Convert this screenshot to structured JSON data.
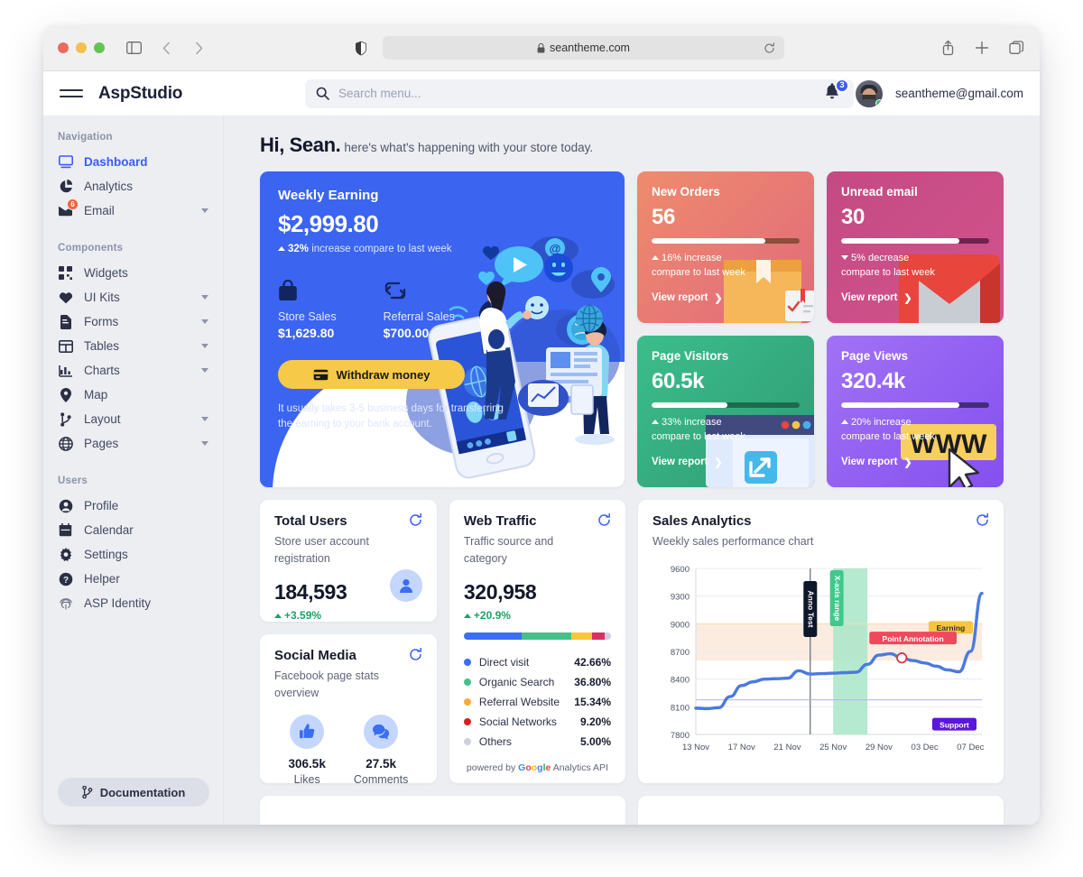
{
  "browser": {
    "url": "seantheme.com",
    "lock_icon": "lock-icon",
    "reload_icon": "reload-icon",
    "back_icon": "back-arrow-icon",
    "forward_icon": "forward-arrow-icon",
    "sidebar_icon": "sidebar-toggle-icon",
    "shield_icon": "shield-icon",
    "share_icon": "share-icon",
    "newtab_icon": "plus-icon",
    "tabs_icon": "tabs-icon"
  },
  "header": {
    "brand": "AspStudio",
    "menu_icon": "hamburger-menu-icon",
    "search": {
      "placeholder": "Search menu...",
      "value": "",
      "icon": "search-icon"
    },
    "notifications": {
      "count": "3",
      "icon": "bell-icon"
    },
    "user": {
      "email": "seantheme@gmail.com",
      "avatar": "user-avatar"
    }
  },
  "sidebar": {
    "sections": [
      {
        "title": "Navigation",
        "items": [
          {
            "label": "Dashboard",
            "icon": "monitor-icon",
            "active": true,
            "caret": false
          },
          {
            "label": "Analytics",
            "icon": "pie-chart-icon",
            "active": false,
            "caret": false
          },
          {
            "label": "Email",
            "icon": "envelope-icon",
            "active": false,
            "caret": true,
            "badge": "6"
          }
        ]
      },
      {
        "title": "Components",
        "items": [
          {
            "label": "Widgets",
            "icon": "widgets-icon",
            "active": false,
            "caret": false
          },
          {
            "label": "UI Kits",
            "icon": "heart-icon",
            "active": false,
            "caret": true
          },
          {
            "label": "Forms",
            "icon": "form-icon",
            "active": false,
            "caret": true
          },
          {
            "label": "Tables",
            "icon": "table-icon",
            "active": false,
            "caret": true
          },
          {
            "label": "Charts",
            "icon": "bar-chart-icon",
            "active": false,
            "caret": true
          },
          {
            "label": "Map",
            "icon": "map-pin-icon",
            "active": false,
            "caret": false
          },
          {
            "label": "Layout",
            "icon": "layout-branch-icon",
            "active": false,
            "caret": true
          },
          {
            "label": "Pages",
            "icon": "globe-icon",
            "active": false,
            "caret": true
          }
        ]
      },
      {
        "title": "Users",
        "items": [
          {
            "label": "Profile",
            "icon": "user-circle-icon",
            "active": false,
            "caret": false
          },
          {
            "label": "Calendar",
            "icon": "calendar-icon",
            "active": false,
            "caret": false
          },
          {
            "label": "Settings",
            "icon": "gear-icon",
            "active": false,
            "caret": false
          },
          {
            "label": "Helper",
            "icon": "question-circle-icon",
            "active": false,
            "caret": false
          },
          {
            "label": "ASP Identity",
            "icon": "fingerprint-icon",
            "active": false,
            "caret": false
          }
        ]
      }
    ],
    "documentation_button": {
      "label": "Documentation",
      "icon": "branch-icon"
    }
  },
  "greeting": {
    "name": "Hi, Sean.",
    "message": "here's what's happening with your store today."
  },
  "weekly_earning": {
    "title": "Weekly Earning",
    "amount": "$2,999.80",
    "change_pct": "32%",
    "change_text": "increase compare to last week",
    "store_sales": {
      "label": "Store Sales",
      "value": "$1,629.80",
      "icon": "shopping-bag-icon"
    },
    "referral_sales": {
      "label": "Referral Sales",
      "value": "$700.00",
      "icon": "retweet-icon"
    },
    "withdraw_button": {
      "label": "Withdraw money",
      "icon": "card-icon"
    },
    "note": "It usually takes 3-5 business days for transferring the earning to your bank account.",
    "bg_color": "#3b64f0",
    "button_color": "#f7c948"
  },
  "stats": [
    {
      "title": "New Orders",
      "value": "56",
      "progress": 77,
      "direction": "up",
      "delta": "16% increase",
      "delta_line2": "compare to last week",
      "link": "View report",
      "art": "package-box",
      "color_from": "#ef8264",
      "color_to": "#e2677e",
      "track_color": "#8a4f3d"
    },
    {
      "title": "Unread email",
      "value": "30",
      "progress": 80,
      "direction": "down",
      "delta": "5% decrease",
      "delta_line2": "compare to last week",
      "link": "View report",
      "art": "gmail-envelope",
      "color_from": "#c0457f",
      "color_to": "#cf4d87",
      "track_color": "#6f2450"
    },
    {
      "title": "Page Visitors",
      "value": "60.5k",
      "progress": 51,
      "direction": "up",
      "delta": "33% increase",
      "delta_line2": "compare to last week",
      "link": "View report",
      "art": "browser-window",
      "color_from": "#35b584",
      "color_to": "#2f9f74",
      "track_color": "#1d6b4d"
    },
    {
      "title": "Page Views",
      "value": "320.4k",
      "progress": 80,
      "direction": "up",
      "delta": "20% increase",
      "delta_line2": "compare to last week",
      "link": "View report",
      "art": "www-tag",
      "color_from": "#9f6cf2",
      "color_to": "#8a55ef",
      "track_color": "#442b7a"
    }
  ],
  "total_users": {
    "title": "Total Users",
    "subtitle": "Store user account registration",
    "value": "184,593",
    "delta": "+3.59%",
    "refresh_icon": "refresh-icon",
    "avatar_icon": "user-icon"
  },
  "social_media": {
    "title": "Social Media",
    "subtitle": "Facebook page stats overview",
    "refresh_icon": "refresh-icon",
    "items": [
      {
        "value": "306.5k",
        "label": "Likes",
        "icon": "thumbs-up-icon"
      },
      {
        "value": "27.5k",
        "label": "Comments",
        "icon": "comments-icon"
      }
    ]
  },
  "web_traffic": {
    "title": "Web Traffic",
    "subtitle": "Traffic source and category",
    "value": "320,958",
    "delta": "+20.9%",
    "refresh_icon": "refresh-icon",
    "powered_by": {
      "prefix": "powered by",
      "brand": "Google",
      "suffix": "Analytics API"
    },
    "chart_data": {
      "type": "pie",
      "title": "Web Traffic",
      "categories": [
        "Direct visit",
        "Organic Search",
        "Referral Website",
        "Social Networks",
        "Others"
      ],
      "values": [
        42.66,
        36.8,
        15.34,
        9.2,
        5.0
      ],
      "labels": [
        "42.66%",
        "36.80%",
        "15.34%",
        "9.20%",
        "5.00%"
      ],
      "colors": [
        "#3b6ef0",
        "#45c08a",
        "#f8c53c",
        "#d82f66",
        "#ccd1dc"
      ],
      "legend": "right"
    }
  },
  "sales_analytics": {
    "title": "Sales Analytics",
    "subtitle": "Weekly sales performance chart",
    "refresh_icon": "refresh-icon",
    "chart_data": {
      "type": "line",
      "title": "Sales Analytics",
      "subtitle": "Weekly sales performance chart",
      "xlabel": "",
      "ylabel": "",
      "ylim": [
        7800,
        9600
      ],
      "yticks": [
        7800,
        8100,
        8400,
        8700,
        9000,
        9300,
        9600
      ],
      "xticks": [
        "13 Nov",
        "17 Nov",
        "21 Nov",
        "25 Nov",
        "29 Nov",
        "03 Dec",
        "07 Dec"
      ],
      "grid": true,
      "series": [
        {
          "name": "Sales",
          "color": "#4a7ae0",
          "x": [
            "13 Nov",
            "14 Nov",
            "15 Nov",
            "16 Nov",
            "17 Nov",
            "18 Nov",
            "19 Nov",
            "20 Nov",
            "21 Nov",
            "22 Nov",
            "23 Nov",
            "24 Nov",
            "25 Nov",
            "26 Nov",
            "27 Nov",
            "28 Nov",
            "29 Nov",
            "30 Nov",
            "01 Dec",
            "02 Dec",
            "03 Dec",
            "04 Dec",
            "05 Dec",
            "06 Dec",
            "07 Dec",
            "08 Dec"
          ],
          "values": [
            8085,
            8080,
            8090,
            8210,
            8330,
            8370,
            8400,
            8405,
            8410,
            8490,
            8455,
            8460,
            8465,
            8470,
            8475,
            8560,
            8660,
            8675,
            8630,
            8600,
            8575,
            8540,
            8500,
            8480,
            8700,
            9330
          ]
        }
      ],
      "annotations": [
        {
          "type": "xaxis-line",
          "label": "Anno Test",
          "x": "23 Nov",
          "bg": "#0f172a",
          "text_color": "#ffffff",
          "orientation": "vertical"
        },
        {
          "type": "xaxis-range",
          "label": "X-axis range",
          "x_from": "25 Nov",
          "x_to": "28 Nov",
          "bg": "#3ec98c",
          "fill": "#a9e6c8",
          "text_color": "#ffffff",
          "orientation": "vertical"
        },
        {
          "type": "point",
          "label": "Point Annotation",
          "x": "01 Dec",
          "y": 8600,
          "bg": "#f0485c",
          "text_color": "#ffffff",
          "marker": "circle-red"
        },
        {
          "type": "yaxis-region",
          "label": "",
          "y_from": 8600,
          "y_to": 9000,
          "fill": "#fcece0"
        },
        {
          "type": "yaxis-line",
          "label": "Earning",
          "y": 9000,
          "bg": "#f5c542",
          "text_color": "#3a3222"
        },
        {
          "type": "yaxis-line",
          "label": "Support",
          "y": 8175,
          "bg": "#5b16d6",
          "text_color": "#ffffff"
        }
      ]
    }
  }
}
